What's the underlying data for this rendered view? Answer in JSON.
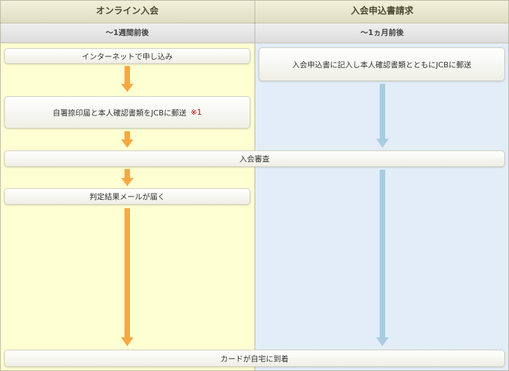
{
  "header": {
    "left_title": "オンライン入会",
    "right_title": "入会申込書請求",
    "left_duration": "～1週間前後",
    "right_duration": "～1ヵ月前後"
  },
  "steps": {
    "online_apply": "インターネットで申し込み",
    "seal_mail": "自署捺印届と本人確認書類をJCBに郵送",
    "seal_mail_note": "※1",
    "paper_mail": "入会申込書に記入し本人確認書類とともにJCBに郵送",
    "screening": "入会審査",
    "result_email": "判定結果メールが届く",
    "card_arrival": "カードが自宅に到着"
  },
  "colors": {
    "left_bg": "#fefed3",
    "right_bg": "#e3edf7",
    "orange_arrow": "#f8a840",
    "blue_arrow": "#a8cce0"
  }
}
